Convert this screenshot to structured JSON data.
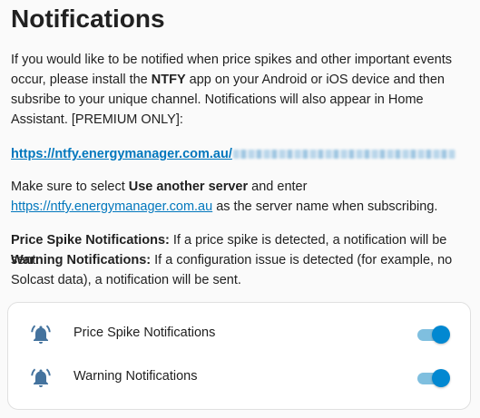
{
  "title": "Notifications",
  "intro": {
    "part1": "If you would like to be notified when price spikes and other important events occur, please install the ",
    "ntfy": "NTFY",
    "part2": " app on your Android or iOS device and then subsribe to your unique channel. Notifications will also appear in Home Assistant. [PREMIUM ONLY]:"
  },
  "channel_link": "https://ntfy.energymanager.com.au/",
  "server_instructions": {
    "part1": "Make sure to select ",
    "use_another_server": "Use another server",
    "part2": " and enter ",
    "server_link": "https://ntfy.energymanager.com.au",
    "part3": " as the server name when subscribing."
  },
  "price_spike_desc": {
    "label": "Price Spike Notifications:",
    "text": " If a price spike is detected, a notification will be sent."
  },
  "warning_desc": {
    "label": "Warning Notifications:",
    "text": " If a configuration issue is detected (for example, no Solcast data), a notification will be sent."
  },
  "settings": [
    {
      "label": "Price Spike Notifications",
      "icon": "bell-ring-icon",
      "enabled": true
    },
    {
      "label": "Warning Notifications",
      "icon": "bell-ring-icon",
      "enabled": true
    }
  ],
  "colors": {
    "link": "#0277bd",
    "icon": "#44739e",
    "toggle_on": "#0288d1"
  }
}
